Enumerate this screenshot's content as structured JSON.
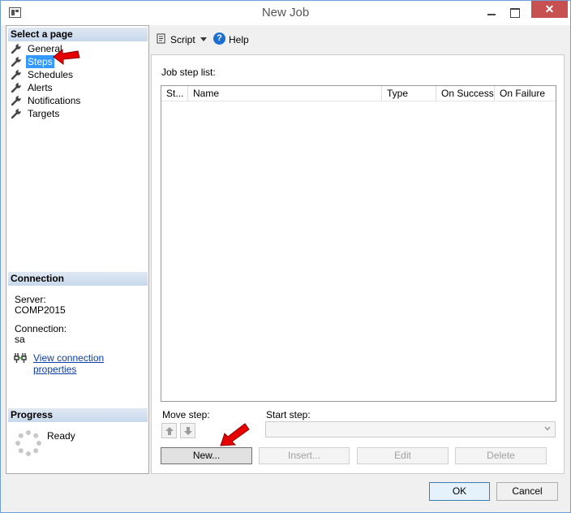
{
  "window": {
    "title": "New Job",
    "close_glyph": "✕"
  },
  "left_pane": {
    "select_page_header": "Select a page",
    "pages": [
      {
        "label": "General"
      },
      {
        "label": "Steps"
      },
      {
        "label": "Schedules"
      },
      {
        "label": "Alerts"
      },
      {
        "label": "Notifications"
      },
      {
        "label": "Targets"
      }
    ],
    "selected_page": "Steps",
    "connection": {
      "header": "Connection",
      "server_label": "Server:",
      "server_value": "COMP2015",
      "connection_label": "Connection:",
      "connection_value": "sa",
      "view_properties_link": "View connection properties"
    },
    "progress": {
      "header": "Progress",
      "status": "Ready"
    }
  },
  "toolbar": {
    "script_label": "Script",
    "help_label": "Help",
    "help_glyph": "?"
  },
  "steps_page": {
    "job_step_list_label": "Job step list:",
    "columns": [
      "St...",
      "Name",
      "Type",
      "On Success",
      "On Failure"
    ],
    "rows": [],
    "move_step_label": "Move step:",
    "start_step_label": "Start step:",
    "start_step_value": "",
    "buttons": {
      "new": "New...",
      "insert": "Insert...",
      "edit": "Edit",
      "delete": "Delete"
    }
  },
  "footer": {
    "ok": "OK",
    "cancel": "Cancel"
  },
  "colors": {
    "selection": "#3399ff",
    "section_header": "#c8d9ec",
    "close_button": "#c75050",
    "link": "#0b3da8",
    "annotation_arrow": "#e60000"
  },
  "icons": [
    "app-icon",
    "wrench-icon",
    "script-icon",
    "help-icon",
    "plug-icon",
    "progress-spinner-icon",
    "arrow-up-icon",
    "arrow-down-icon",
    "chevron-down-icon",
    "red-annotation-arrow"
  ]
}
